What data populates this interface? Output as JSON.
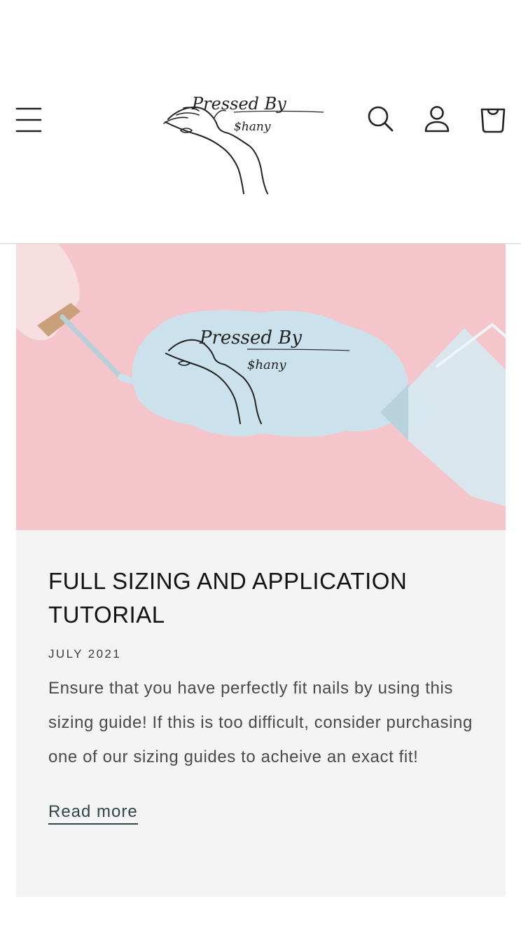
{
  "header": {
    "logo": {
      "line1": "Pressed By",
      "line2": "$hany"
    },
    "icons": {
      "menu": "menu-icon",
      "search": "search-icon",
      "account": "account-icon",
      "cart": "cart-icon"
    }
  },
  "article": {
    "image_logo": {
      "line1": "Pressed By",
      "line2": "$hany"
    },
    "title": "FULL SIZING AND APPLICATION TUTORIAL",
    "date": "JULY 2021",
    "excerpt": "Ensure that you have perfectly fit nails by using this sizing guide! If this is too difficult, consider purchasing one of our sizing guides to acheive an exact fit!",
    "read_more": "Read more"
  },
  "colors": {
    "image_background": "#f4c6cb",
    "polish_blue": "#cbe2ec",
    "card_background": "#f4f4f4",
    "link": "#32454a"
  }
}
